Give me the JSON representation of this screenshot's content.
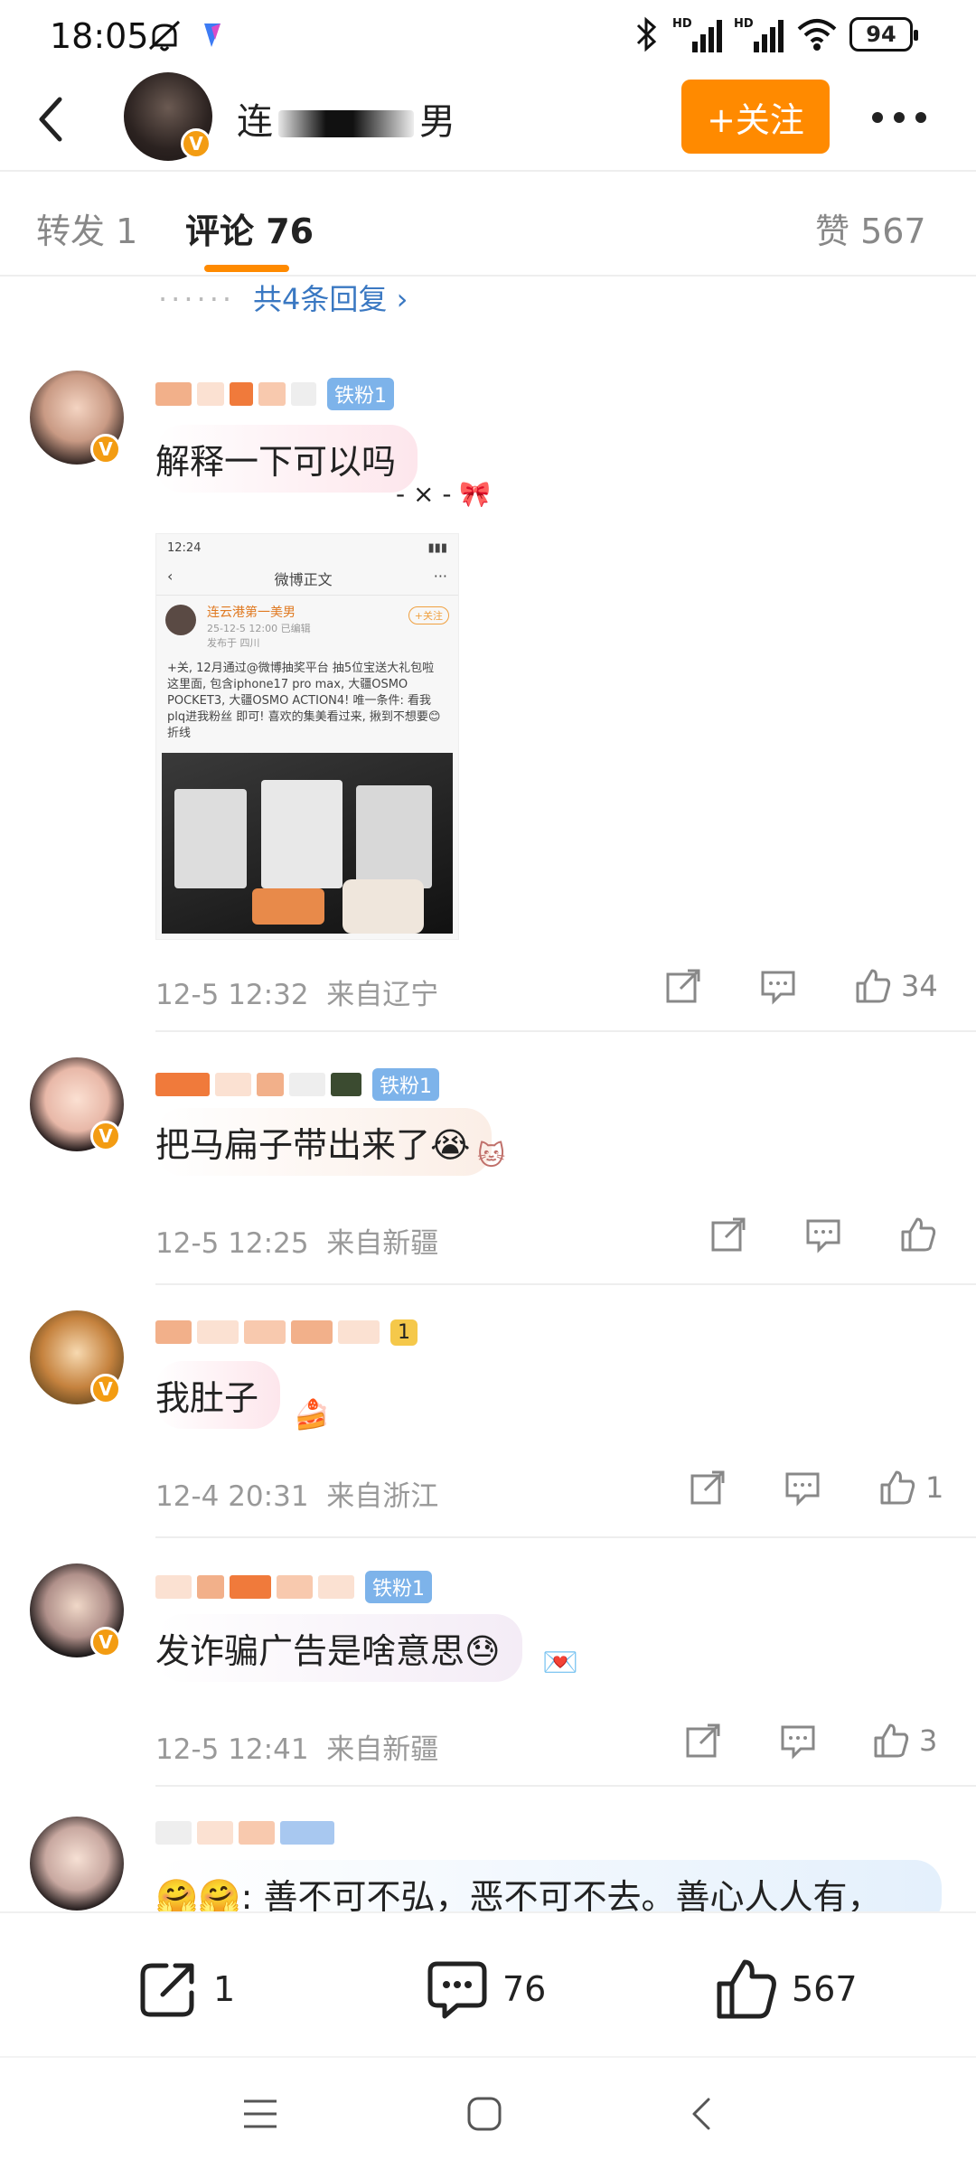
{
  "status_bar": {
    "time": "18:05",
    "battery": "94"
  },
  "header": {
    "name_start": "连",
    "name_end": "男",
    "follow_label": "+关注"
  },
  "tabs": [
    {
      "label": "转发 1"
    },
    {
      "label": "评论 76"
    },
    {
      "label": "赞 567"
    }
  ],
  "reply_link": "共4条回复 ›",
  "comments": [
    {
      "fan_badge": "铁粉1",
      "text": "解释一下可以吗",
      "time": "12-5 12:32",
      "location": "来自辽宁",
      "likes": "34",
      "screenshot": {
        "time": "12:24",
        "title": "微博正文",
        "user": "连云港第一美男",
        "follow": "+关注",
        "meta": "25-12-5 12:00  已编辑",
        "place": "发布于 四川",
        "body": "+关, 12月通过@微博抽奖平台 抽5位宝送大礼包啦 这里面, 包含iphone17 pro max, 大疆OSMO POCKET3, 大疆OSMO ACTION4! 唯一条件: 看我plq进我粉丝 即可! 喜欢的集美看过来, 揪到不想要😊折线"
      }
    },
    {
      "fan_badge": "铁粉1",
      "text": "把马扁子带出来了😭",
      "time": "12-5 12:25",
      "location": "来自新疆",
      "likes": ""
    },
    {
      "fan_badge": "1",
      "text": "我肚子",
      "time": "12-4 20:31",
      "location": "来自浙江",
      "likes": "1"
    },
    {
      "fan_badge": "铁粉1",
      "text": "发诈骗广告是啥意思😓",
      "time": "12-5 12:41",
      "location": "来自新疆",
      "likes": "3"
    },
    {
      "text": "🤗🤗: 善不可不弘，恶不可不去。善心人人有，"
    }
  ],
  "bottom_bar": {
    "reposts": "1",
    "comments": "76",
    "likes": "567"
  }
}
